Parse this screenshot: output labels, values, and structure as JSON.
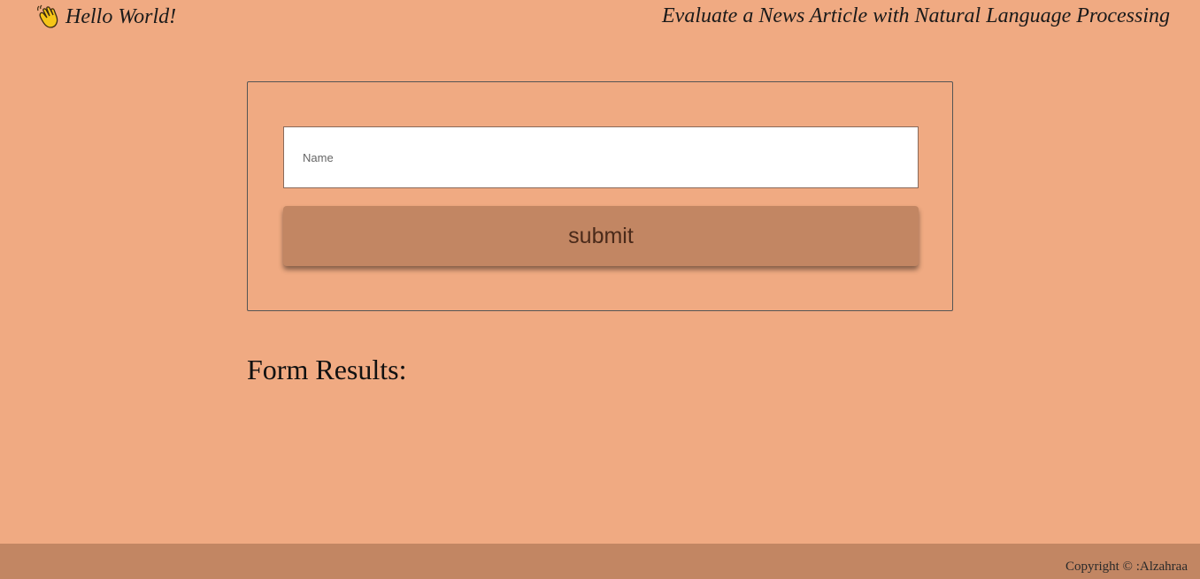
{
  "header": {
    "brand_text": "Hello World!",
    "brand_icon": "waving-hand-icon",
    "tagline": "Evaluate a News Article with Natural Language Processing"
  },
  "form": {
    "name_placeholder": "Name",
    "name_value": "",
    "submit_label": "submit"
  },
  "results": {
    "title": "Form Results:"
  },
  "footer": {
    "copyright": "Copyright © :Alzahraa"
  },
  "colors": {
    "background": "#f0aa82",
    "accent": "#c28663"
  }
}
